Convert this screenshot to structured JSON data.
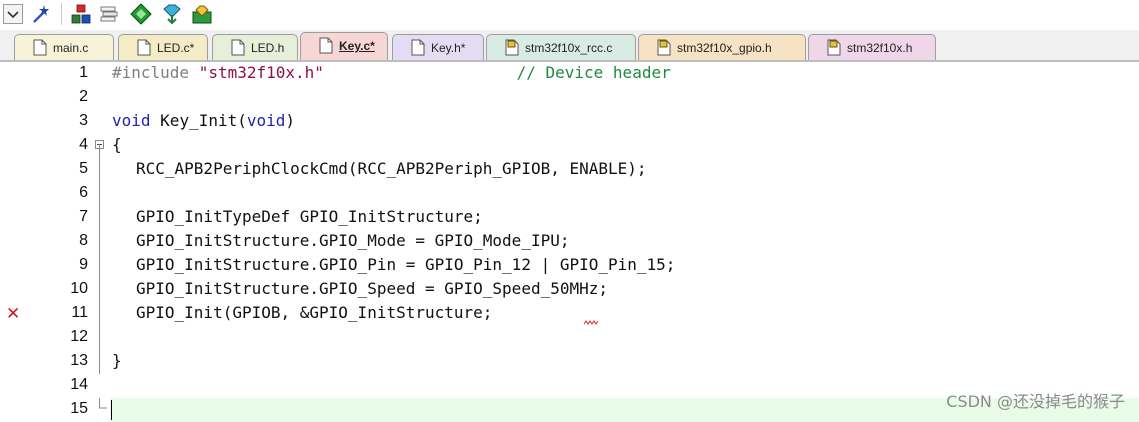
{
  "tabs": [
    {
      "label": "main.c",
      "active": false
    },
    {
      "label": "LED.c*",
      "active": false
    },
    {
      "label": "LED.h",
      "active": false
    },
    {
      "label": "Key.c*",
      "active": true
    },
    {
      "label": "Key.h*",
      "active": false
    },
    {
      "label": "stm32f10x_rcc.c",
      "active": false
    },
    {
      "label": "stm32f10x_gpio.h",
      "active": false
    },
    {
      "label": "stm32f10x.h",
      "active": false
    }
  ],
  "editor": {
    "line_numbers": [
      "1",
      "2",
      "3",
      "4",
      "5",
      "6",
      "7",
      "8",
      "9",
      "10",
      "11",
      "12",
      "13",
      "14",
      "15"
    ],
    "lines": {
      "l1_pp": "#include",
      "l1_str": "\"stm32f10x.h\"",
      "l1_cmt": "// Device header",
      "l3_kw1": "void",
      "l3_fn": "Key_Init(",
      "l3_kw2": "void",
      "l3_close": ")",
      "l4": "{",
      "l5": "RCC_APB2PeriphClockCmd(RCC_APB2Periph_GPIOB, ENABLE);",
      "l7": "GPIO_InitTypeDef GPIO_InitStructure;",
      "l8": "GPIO_InitStructure.GPIO_Mode = GPIO_Mode_IPU;",
      "l9": "GPIO_InitStructure.GPIO_Pin = GPIO_Pin_12 | GPIO_Pin_15;",
      "l10": "GPIO_InitStructure.GPIO_Speed = GPIO_Speed_50MHz;",
      "l11": "GPIO_Init(GPIOB, &GPIO_InitStructure;",
      "l13": "}"
    },
    "error_line": "11",
    "error_icon": "red-x-icon"
  },
  "watermark": "CSDN @还没掉毛的猴子",
  "colors": {
    "tab_main": "#f8f3d8",
    "tab_led_c": "#f4ecc6",
    "tab_led_h": "#e6f0d8",
    "tab_key_c": "#f7d6d6",
    "tab_key_h": "#e3dcf3",
    "tab_rcc": "#d8ece4",
    "tab_gpio": "#f5e3c4",
    "tab_stm32": "#efd6e9",
    "cursor_line": "#e8fce8"
  }
}
